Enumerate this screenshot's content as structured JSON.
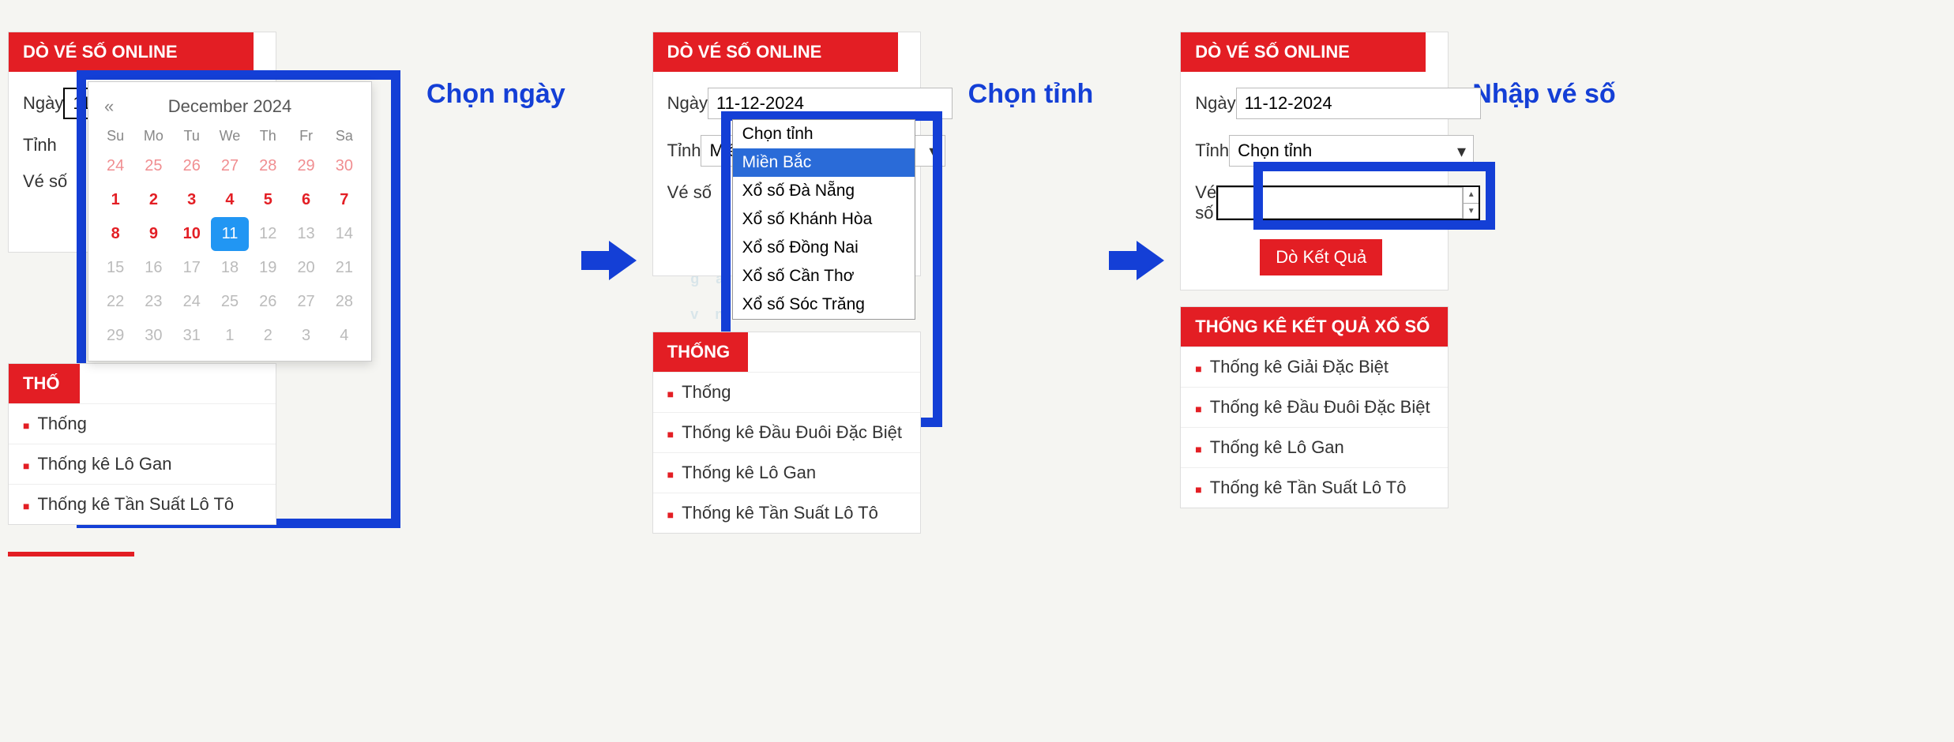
{
  "header_title": "DÒ VÉ SỐ ONLINE",
  "stats_header": "THỐNG KÊ KẾT QUẢ XỔ SỐ",
  "stats_header_short": "THỐ",
  "stats_header_short2": "THỐNG",
  "labels": {
    "ngay": "Ngày",
    "tinh": "Tỉnh",
    "veso": "Vé số"
  },
  "date_value": "11-12-2024",
  "date_value_caret": "11-12-2024",
  "province_selected": "Miền Bắc",
  "province_placeholder": "Chọn tỉnh",
  "submit_label": "Dò Kết Quả",
  "stats_items": {
    "0": "Thống kê Giải Đặc Biệt",
    "1": "Thống kê Đầu Đuôi Đặc Biệt",
    "2": "Thống kê Lô Gan",
    "3": "Thống kê Tần Suất Lô Tô"
  },
  "stats_items_first_trunc": "Thống",
  "step_labels": {
    "0": "Chọn ngày",
    "1": "Chọn tỉnh",
    "2": "Nhập vé số"
  },
  "calendar": {
    "title": "December 2024",
    "prev": "«",
    "dow": {
      "0": "Su",
      "1": "Mo",
      "2": "Tu",
      "3": "We",
      "4": "Th",
      "5": "Fr",
      "6": "Sa"
    },
    "cells": [
      {
        "n": "24",
        "cls": "prev-m"
      },
      {
        "n": "25",
        "cls": "prev-m"
      },
      {
        "n": "26",
        "cls": "prev-m"
      },
      {
        "n": "27",
        "cls": "prev-m"
      },
      {
        "n": "28",
        "cls": "prev-m"
      },
      {
        "n": "29",
        "cls": "prev-m"
      },
      {
        "n": "30",
        "cls": "prev-m"
      },
      {
        "n": "1",
        "cls": "red"
      },
      {
        "n": "2",
        "cls": "red"
      },
      {
        "n": "3",
        "cls": "red"
      },
      {
        "n": "4",
        "cls": "red"
      },
      {
        "n": "5",
        "cls": "red"
      },
      {
        "n": "6",
        "cls": "red"
      },
      {
        "n": "7",
        "cls": "red"
      },
      {
        "n": "8",
        "cls": "red"
      },
      {
        "n": "9",
        "cls": "red"
      },
      {
        "n": "10",
        "cls": "red"
      },
      {
        "n": "11",
        "cls": "cell-sel"
      },
      {
        "n": "12",
        "cls": "dim"
      },
      {
        "n": "13",
        "cls": "dim"
      },
      {
        "n": "14",
        "cls": "dim"
      },
      {
        "n": "15",
        "cls": "dim"
      },
      {
        "n": "16",
        "cls": "dim"
      },
      {
        "n": "17",
        "cls": "dim"
      },
      {
        "n": "18",
        "cls": "dim"
      },
      {
        "n": "19",
        "cls": "dim"
      },
      {
        "n": "20",
        "cls": "dim"
      },
      {
        "n": "21",
        "cls": "dim"
      },
      {
        "n": "22",
        "cls": "dim"
      },
      {
        "n": "23",
        "cls": "dim"
      },
      {
        "n": "24",
        "cls": "dim"
      },
      {
        "n": "25",
        "cls": "dim"
      },
      {
        "n": "26",
        "cls": "dim"
      },
      {
        "n": "27",
        "cls": "dim"
      },
      {
        "n": "28",
        "cls": "dim"
      },
      {
        "n": "29",
        "cls": "dim"
      },
      {
        "n": "30",
        "cls": "dim"
      },
      {
        "n": "31",
        "cls": "dim"
      },
      {
        "n": "1",
        "cls": "dim"
      },
      {
        "n": "2",
        "cls": "dim"
      },
      {
        "n": "3",
        "cls": "dim"
      },
      {
        "n": "4",
        "cls": "dim"
      }
    ]
  },
  "provinces": {
    "0": "Chọn tỉnh",
    "1": "Miền Bắc",
    "2": "Xổ số Đà Nẵng",
    "3": "Xổ số Khánh Hòa",
    "4": "Xổ số Đồng Nai",
    "5": "Xổ số Cần Thơ",
    "6": "Xổ số Sóc Trăng"
  },
  "watermark": "g a m e o r b . v n"
}
